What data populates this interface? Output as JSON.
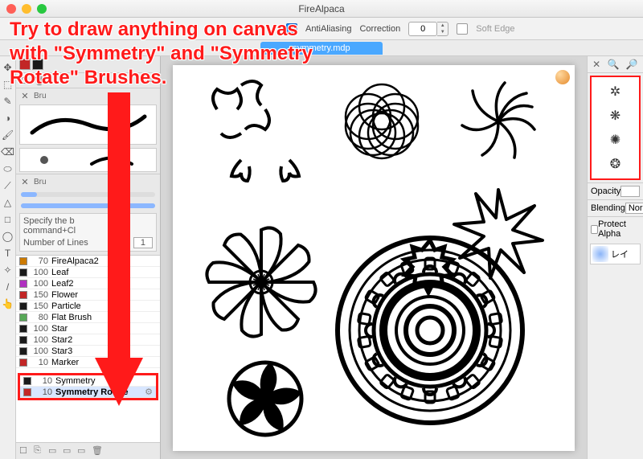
{
  "window": {
    "title": "FireAlpaca"
  },
  "toolbar": {
    "antialias_label": "AntiAliasing",
    "antialias_checked": true,
    "correction_label": "Correction",
    "correction_value": "0",
    "softedge_label": "Soft Edge",
    "softedge_checked": false
  },
  "tab": {
    "filename": "symmetry.mdp"
  },
  "tools": [
    "✥",
    "⬚",
    "✎",
    "◑",
    "🖌",
    "⌫",
    "⬭",
    "⟋",
    "△",
    "□",
    "◯",
    "T",
    "✧",
    "/",
    "👆"
  ],
  "swatches": [
    "#c22626",
    "#1a1a1a"
  ],
  "sliders": {
    "size_value": "10",
    "opacity_value": "100 %"
  },
  "specify": {
    "line1": "Specify the b",
    "line2": "command+Cl",
    "numlines_label": "Number of Lines",
    "numlines_value": "1"
  },
  "brushes": [
    {
      "color": "#cc7a00",
      "size": "70",
      "name": "FireAlpaca2"
    },
    {
      "color": "#1a1a1a",
      "size": "100",
      "name": "Leaf"
    },
    {
      "color": "#b030c0",
      "size": "100",
      "name": "Leaf2"
    },
    {
      "color": "#c22626",
      "size": "150",
      "name": "Flower"
    },
    {
      "color": "#1a1a1a",
      "size": "150",
      "name": "Particle"
    },
    {
      "color": "#58a858",
      "size": "80",
      "name": "Flat Brush"
    },
    {
      "color": "#1a1a1a",
      "size": "100",
      "name": "Star"
    },
    {
      "color": "#1a1a1a",
      "size": "100",
      "name": "Star2"
    },
    {
      "color": "#1a1a1a",
      "size": "100",
      "name": "Star3"
    },
    {
      "color": "#c22626",
      "size": "10",
      "name": "Marker"
    }
  ],
  "highlighted_brushes": [
    {
      "color": "#1a1a1a",
      "size": "10",
      "name": "Symmetry"
    },
    {
      "color": "#c22626",
      "size": "10",
      "name": "Symmetry Rotate"
    }
  ],
  "right": {
    "nav_icons": [
      "✕",
      "🔍",
      "🔎"
    ],
    "opacity_label": "Opacity",
    "blending_label": "Blending",
    "blending_value": "Norm",
    "protect_label": "Protect Alpha",
    "layer_name": "レイ"
  },
  "annotation": {
    "text": "Try to draw anything on canvas with \"Symmetry\" and \"Symmetry Rotate\" Brushes."
  }
}
